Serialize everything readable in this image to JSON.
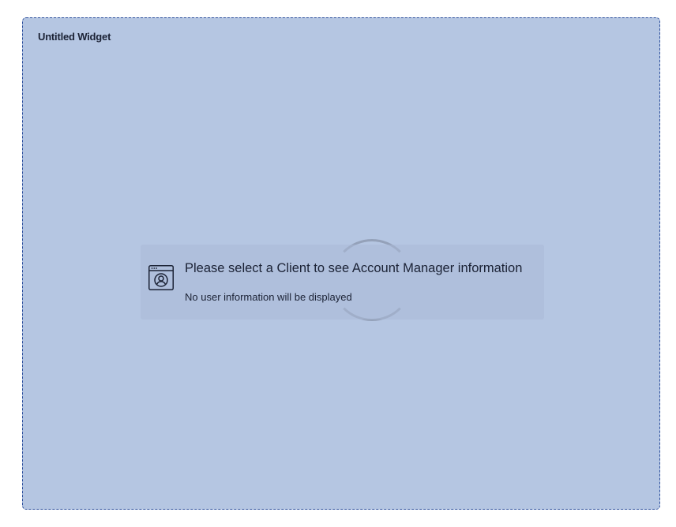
{
  "widget": {
    "title": "Untitled Widget"
  },
  "notice": {
    "icon": "user-window-icon",
    "title": "Please select a Client to see Account Manager information",
    "subtitle": "No user information will be displayed"
  },
  "loading": {
    "icon": "spinner-icon"
  },
  "colors": {
    "widget_background": "#b5c6e2",
    "widget_border": "#2a4d9c",
    "text": "#1b2235"
  }
}
